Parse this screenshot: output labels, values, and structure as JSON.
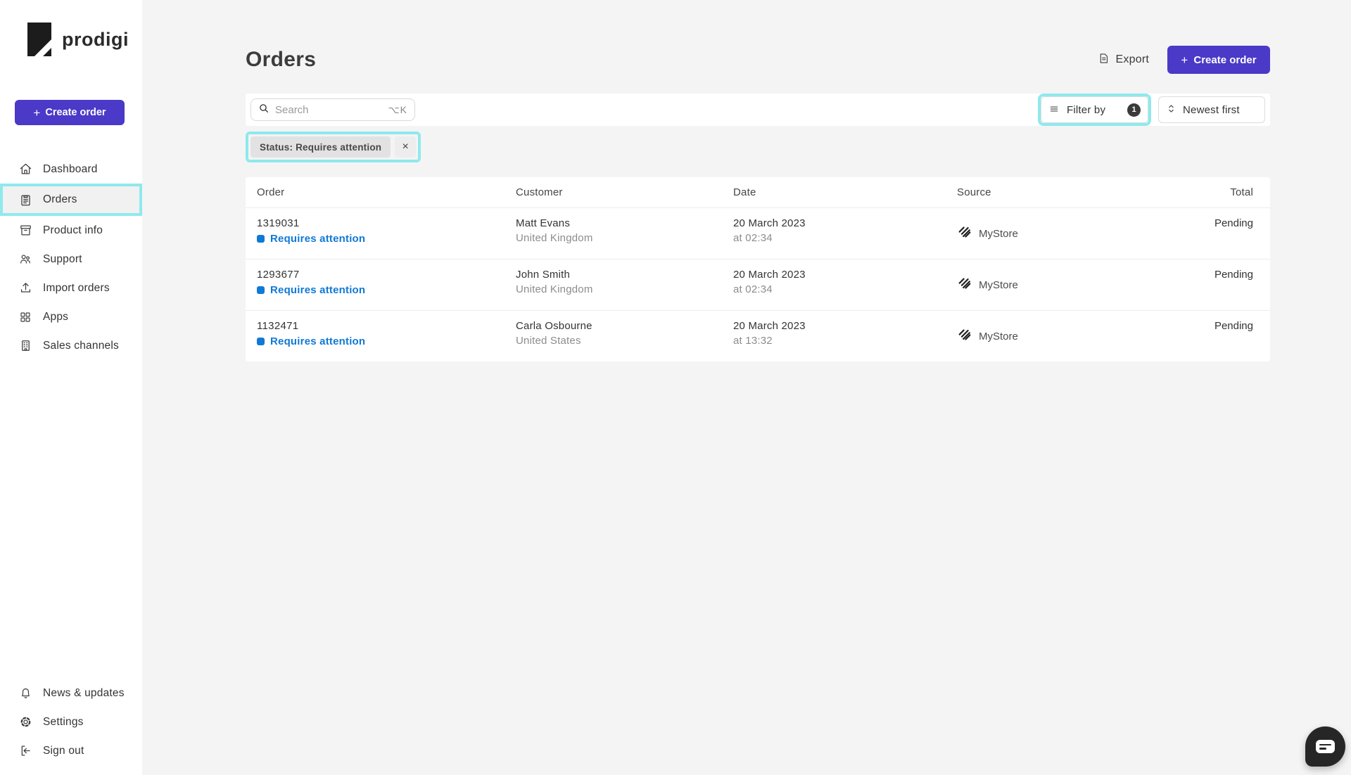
{
  "colors": {
    "accent_purple": "#4b39c8",
    "annotation_cyan": "#8fe9ed",
    "status_blue": "#1079d6",
    "page_bg": "#f4f4f4"
  },
  "brand": {
    "logo_text": "prodigi"
  },
  "sidebar": {
    "create_order": {
      "plus": "+",
      "label": "Create order"
    },
    "items": [
      {
        "label": "Dashboard",
        "icon": "home-icon"
      },
      {
        "label": "Orders",
        "icon": "clipboard-icon",
        "selected": true
      },
      {
        "label": "Product info",
        "icon": "box-icon"
      },
      {
        "label": "Support",
        "icon": "people-icon"
      },
      {
        "label": "Import orders",
        "icon": "upload-icon"
      },
      {
        "label": "Apps",
        "icon": "grid-icon"
      },
      {
        "label": "Sales channels",
        "icon": "building-icon"
      }
    ],
    "footer_items": [
      {
        "label": "News & updates",
        "icon": "bell-icon"
      },
      {
        "label": "Settings",
        "icon": "gear-icon"
      },
      {
        "label": "Sign out",
        "icon": "sign-out-icon"
      }
    ]
  },
  "header": {
    "title": "Orders",
    "export_label": "Export",
    "create_order": {
      "plus": "+",
      "label": "Create order"
    }
  },
  "toolbar": {
    "search": {
      "placeholder": "Search",
      "shortcut": "⌥K"
    },
    "filter": {
      "label": "Filter by",
      "badge_count": "1"
    },
    "sort": {
      "label": "Newest first"
    }
  },
  "filter_chip": {
    "label": "Status: Requires attention",
    "close": "×"
  },
  "table": {
    "columns": [
      "Order",
      "Customer",
      "Date",
      "Source",
      "Total"
    ],
    "rows": [
      {
        "order_id": "1319031",
        "status": "Requires attention",
        "customer": "Matt Evans",
        "country": "United Kingdom",
        "date": "20 March 2023",
        "time": "at 02:34",
        "source": "MyStore",
        "total": "Pending"
      },
      {
        "order_id": "1293677",
        "status": "Requires attention",
        "customer": "John Smith",
        "country": "United Kingdom",
        "date": "20 March 2023",
        "time": "at 02:34",
        "source": "MyStore",
        "total": "Pending"
      },
      {
        "order_id": "1132471",
        "status": "Requires attention",
        "customer": "Carla Osbourne",
        "country": "United States",
        "date": "20 March 2023",
        "time": "at 13:32",
        "source": "MyStore",
        "total": "Pending"
      }
    ]
  }
}
